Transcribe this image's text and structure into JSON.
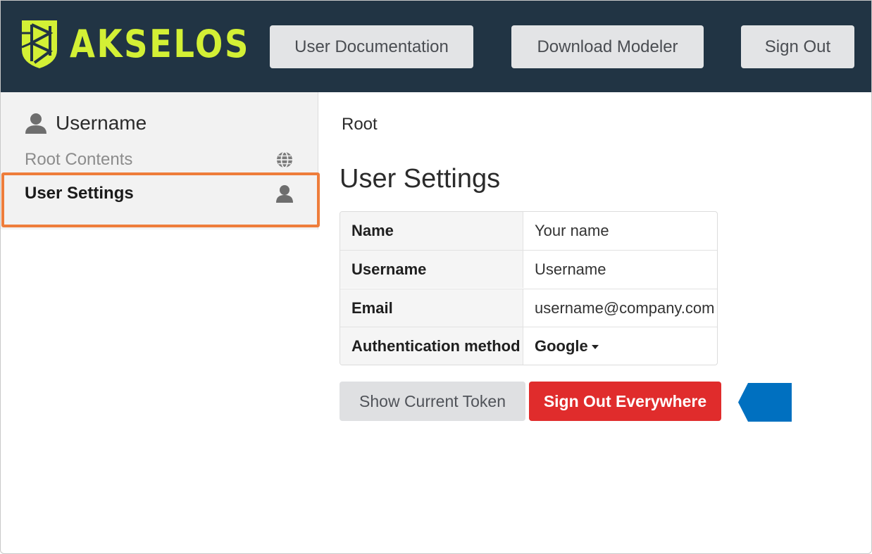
{
  "header": {
    "brand": "AKSELOS",
    "user_docs_label": "User Documentation",
    "download_label": "Download Modeler",
    "sign_out_label": "Sign Out",
    "background_color": "#213444",
    "brand_color": "#d3f035"
  },
  "sidebar": {
    "user_icon": "user-icon",
    "username": "Username",
    "items": [
      {
        "label": "Root Contents",
        "icon": "globe-icon"
      },
      {
        "label": "User Settings",
        "icon": "user-icon",
        "active": true
      }
    ],
    "highlight_color": "#ee7d3b"
  },
  "main": {
    "breadcrumb": "Root",
    "title": "User Settings",
    "rows": [
      {
        "key": "Name",
        "value": "Your name"
      },
      {
        "key": "Username",
        "value": "Username"
      },
      {
        "key": "Email",
        "value": "username@company.com"
      },
      {
        "key": "Authentication method",
        "value": "Google"
      }
    ],
    "show_token_label": "Show Current Token",
    "sign_out_everywhere_label": "Sign Out Everywhere",
    "danger_color": "#e02c2c",
    "pointer_color": "#0070c0"
  }
}
